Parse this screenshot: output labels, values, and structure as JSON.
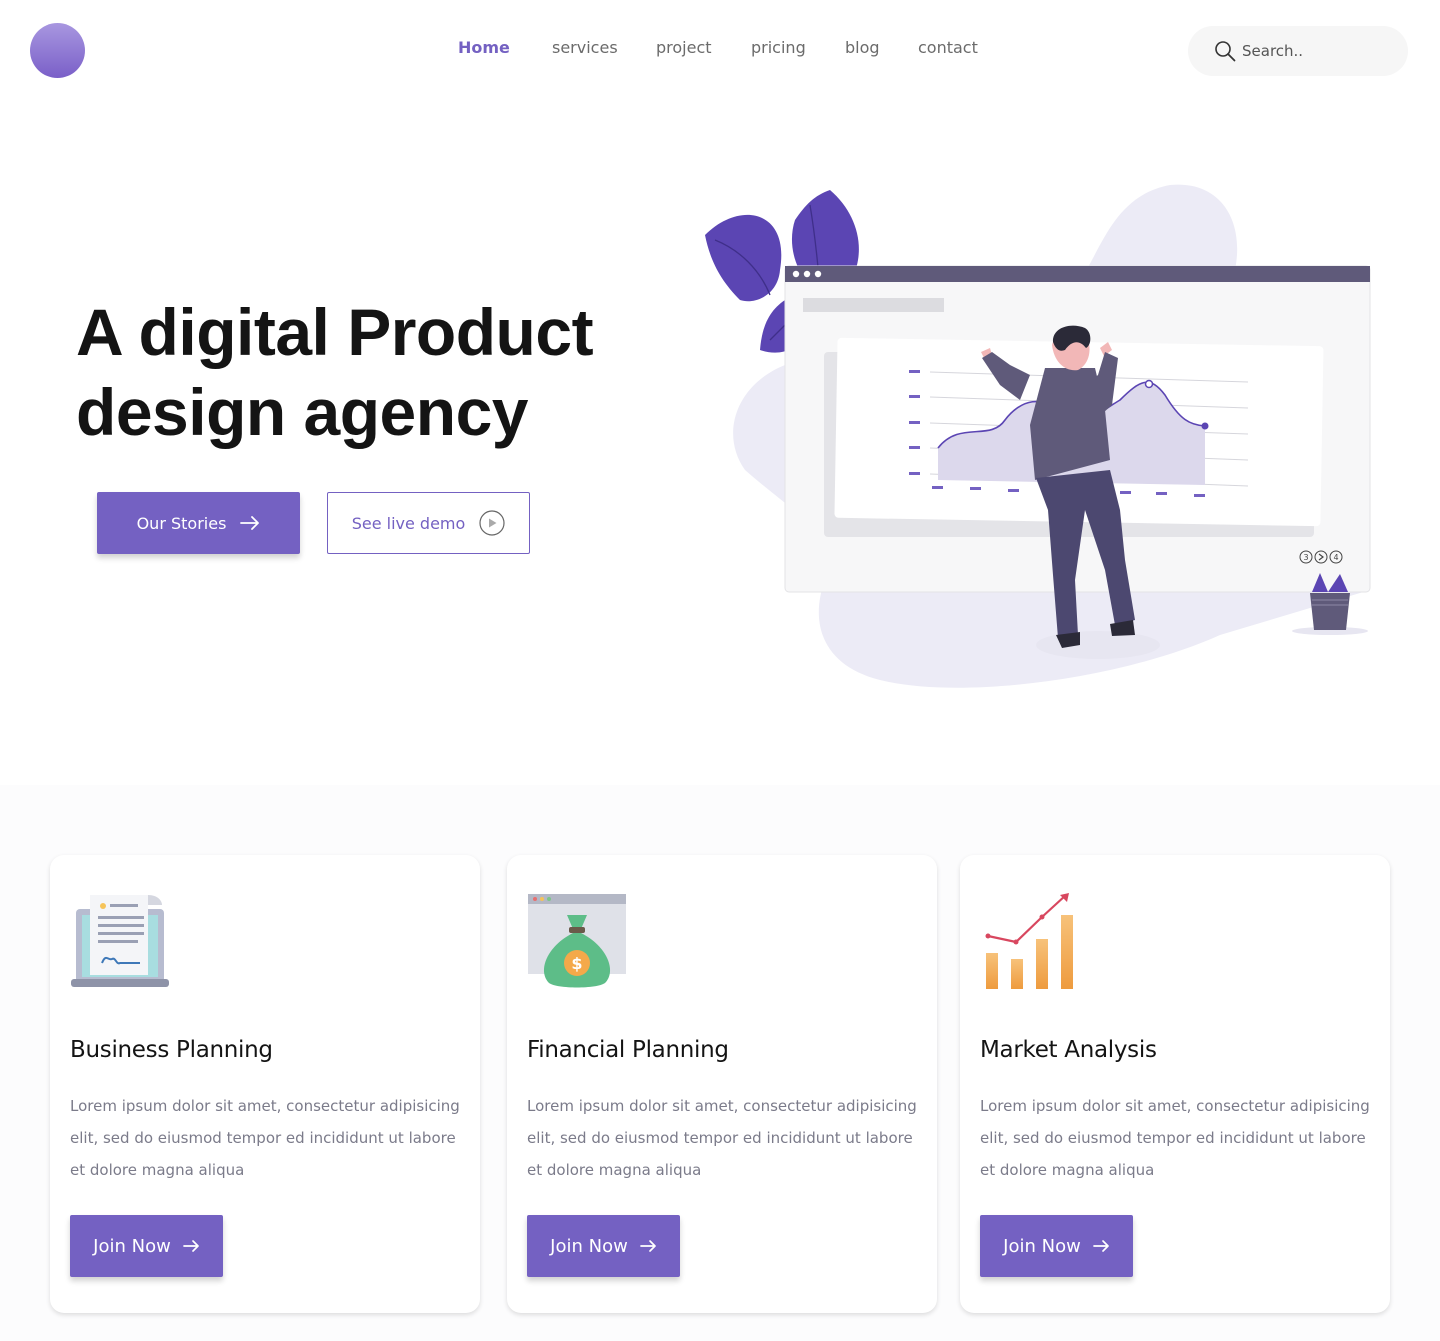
{
  "colors": {
    "accent": "#7461c2",
    "heading": "#141414",
    "muted": "#7b7b8a"
  },
  "header": {
    "nav": [
      {
        "label": "Home",
        "active": true
      },
      {
        "label": "services"
      },
      {
        "label": "project"
      },
      {
        "label": "pricing"
      },
      {
        "label": "blog"
      },
      {
        "label": "contact"
      }
    ],
    "search": {
      "placeholder": "Search..",
      "icon": "search-icon"
    }
  },
  "hero": {
    "title_line1": "A digital Product",
    "title_line2": "design agency",
    "primary_button": {
      "label": "Our Stories",
      "icon": "arrow-right-icon"
    },
    "secondary_button": {
      "label": "See live demo",
      "icon": "play-circle-icon"
    },
    "illustration": {
      "pagination": [
        "3",
        "",
        "4"
      ]
    }
  },
  "services": [
    {
      "title": "Business Planning",
      "icon": "contract-laptop-icon",
      "body": "Lorem ipsum dolor sit amet, consectetur adipisicing elit, sed do eiusmod tempor ed incididunt ut labore et dolore magna aliqua",
      "button": "Join Now"
    },
    {
      "title": "Financial Planning",
      "icon": "money-bag-icon",
      "body": "Lorem ipsum dolor sit amet, consectetur adipisicing elit, sed do eiusmod tempor ed incididunt ut labore et dolore magna aliqua",
      "button": "Join Now"
    },
    {
      "title": "Market Analysis",
      "icon": "growth-chart-icon",
      "body": "Lorem ipsum dolor sit amet, consectetur adipisicing elit, sed do eiusmod tempor ed incididunt ut labore et dolore magna aliqua",
      "button": "Join Now"
    }
  ]
}
